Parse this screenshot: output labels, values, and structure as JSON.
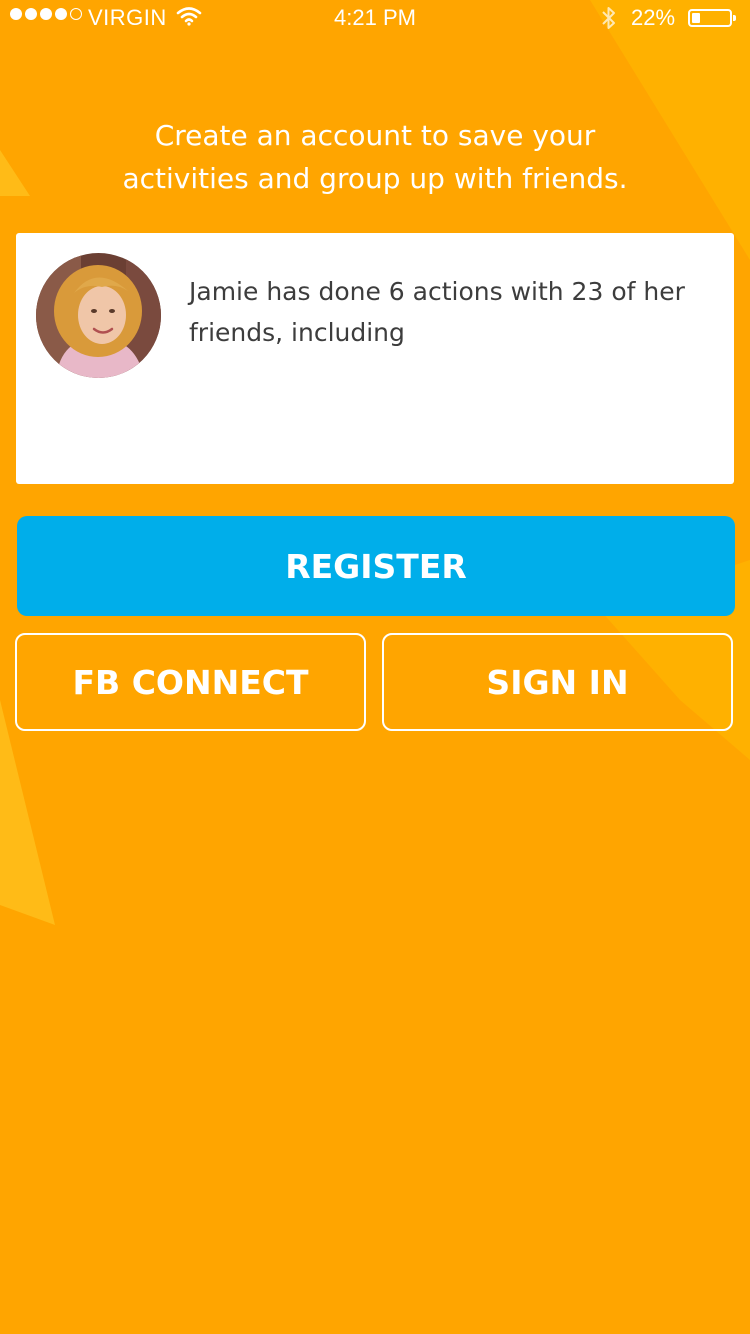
{
  "status_bar": {
    "carrier": "VIRGIN",
    "time": "4:21 PM",
    "battery_percent": "22%",
    "battery_level": 0.22,
    "signal_bars_filled": 4,
    "signal_bars_total": 5
  },
  "heading": {
    "line1": "Create an account to save your",
    "line2": "activities and group up with friends."
  },
  "card": {
    "text_line1": "Jamie has done 6 actions with 23 of her",
    "text_line2": "friends, including"
  },
  "buttons": {
    "register_label": "REGISTER",
    "fb_connect_label": "FB CONNECT",
    "sign_in_label": "SIGN IN"
  },
  "colors": {
    "background": "#FFA500",
    "accent_blue": "#00AEEA",
    "highlight": "#FFB400"
  }
}
